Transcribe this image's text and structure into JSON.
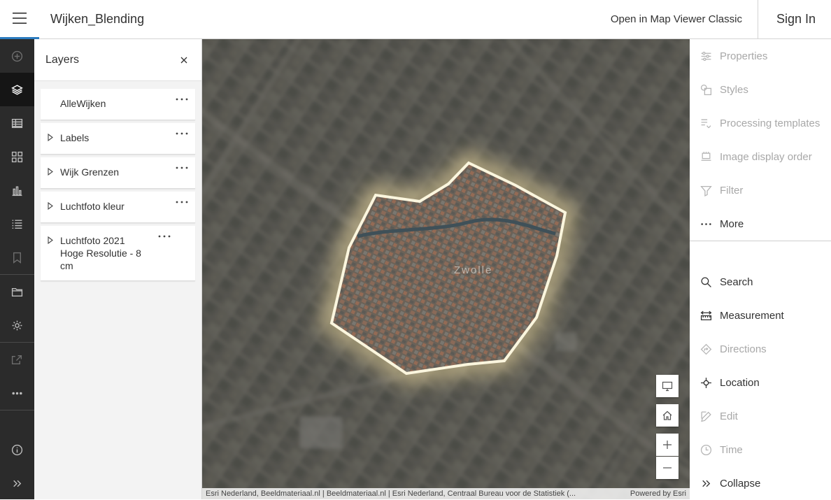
{
  "header": {
    "title": "Wijken_Blending",
    "open_classic": "Open in Map Viewer Classic",
    "sign_in": "Sign In"
  },
  "actionbar": {
    "items": [
      {
        "name": "add",
        "icon": "plus-circle-icon"
      },
      {
        "name": "layers",
        "icon": "layers-icon"
      },
      {
        "name": "tables",
        "icon": "table-icon"
      },
      {
        "name": "basemap",
        "icon": "basemap-gallery-icon"
      },
      {
        "name": "charts",
        "icon": "chart-icon"
      },
      {
        "name": "legend",
        "icon": "legend-list-icon"
      },
      {
        "name": "bookmarks",
        "icon": "bookmark-icon"
      },
      {
        "name": "open",
        "icon": "folder-icon"
      },
      {
        "name": "settings",
        "icon": "gear-icon"
      },
      {
        "name": "share",
        "icon": "share-icon"
      },
      {
        "name": "more",
        "icon": "ellipsis-icon"
      },
      {
        "name": "about",
        "icon": "info-icon"
      },
      {
        "name": "expand",
        "icon": "chevrons-right-icon"
      }
    ]
  },
  "layers_panel": {
    "title": "Layers",
    "layers": [
      {
        "name": "AlleWijken",
        "expandable": false
      },
      {
        "name": "Labels",
        "expandable": true
      },
      {
        "name": "Wijk Grenzen",
        "expandable": true
      },
      {
        "name": "Luchtfoto kleur",
        "expandable": true
      },
      {
        "name": "Luchtfoto 2021 Hoge Resolutie - 8 cm",
        "expandable": true
      }
    ]
  },
  "map": {
    "label": "Zwolle",
    "attribution": "Esri Nederland, Beeldmateriaal.nl | Beeldmateriaal.nl | Esri Nederland, Centraal Bureau voor de Statistiek (...",
    "powered_by": "Powered by Esri",
    "controls": [
      "monitor-icon",
      "home-icon",
      "zoom-in-icon",
      "zoom-out-icon"
    ]
  },
  "rightbar": {
    "top_items": [
      {
        "label": "Properties",
        "icon": "sliders-icon",
        "enabled": false
      },
      {
        "label": "Styles",
        "icon": "styles-icon",
        "enabled": false
      },
      {
        "label": "Processing templates",
        "icon": "processing-icon",
        "enabled": false
      },
      {
        "label": "Image display order",
        "icon": "display-order-icon",
        "enabled": false
      },
      {
        "label": "Filter",
        "icon": "filter-icon",
        "enabled": false
      },
      {
        "label": "More",
        "icon": "ellipsis-icon",
        "enabled": true
      }
    ],
    "bottom_items": [
      {
        "label": "Search",
        "icon": "search-icon",
        "enabled": true
      },
      {
        "label": "Measurement",
        "icon": "measure-icon",
        "enabled": true
      },
      {
        "label": "Directions",
        "icon": "directions-icon",
        "enabled": false
      },
      {
        "label": "Location",
        "icon": "crosshair-icon",
        "enabled": true
      },
      {
        "label": "Edit",
        "icon": "edit-icon",
        "enabled": false
      },
      {
        "label": "Time",
        "icon": "clock-icon",
        "enabled": false
      },
      {
        "label": "Collapse",
        "icon": "chevrons-right-icon",
        "enabled": true
      }
    ]
  }
}
